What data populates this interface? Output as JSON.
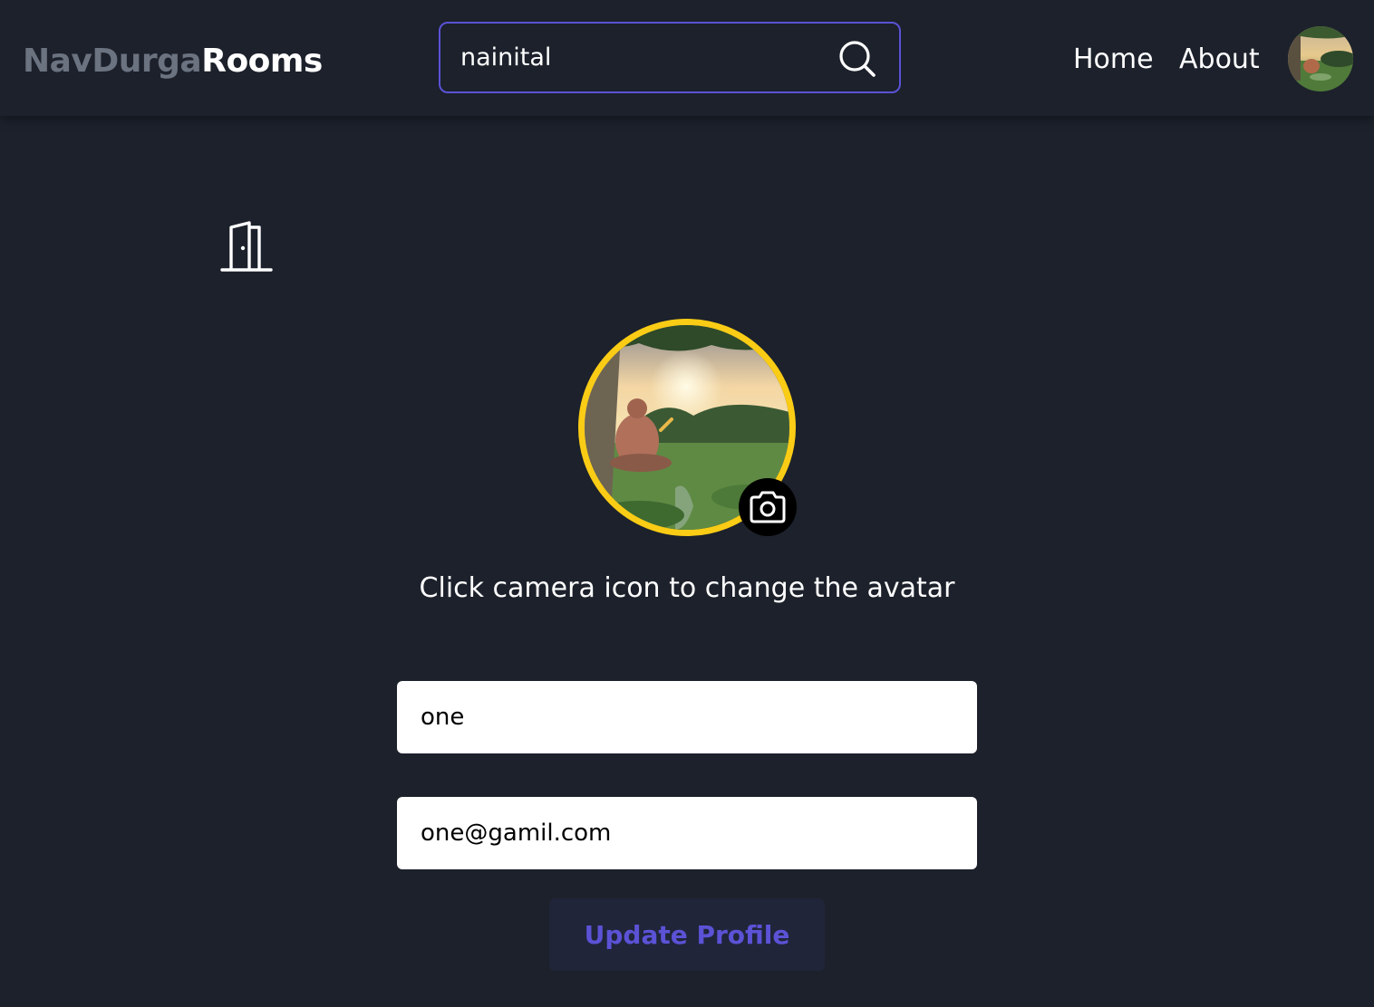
{
  "header": {
    "logo_part1": "NavDurga",
    "logo_part2": "Rooms",
    "search": {
      "value": "nainital",
      "icon": "search-icon"
    },
    "nav": [
      {
        "label": "Home"
      },
      {
        "label": "About"
      }
    ],
    "avatar_icon": "user-avatar"
  },
  "main": {
    "logout_icon": "door-icon",
    "avatar": {
      "ring_color": "#facc15",
      "camera_icon": "camera-icon"
    },
    "hint": "Click camera icon to change the avatar",
    "name_value": "one",
    "email_value": "one@gamil.com",
    "update_label": "Update Profile"
  },
  "colors": {
    "background": "#1c212b",
    "accent": "#5b52d6",
    "logo_muted": "#6b7280",
    "button_bg": "#20253a"
  }
}
